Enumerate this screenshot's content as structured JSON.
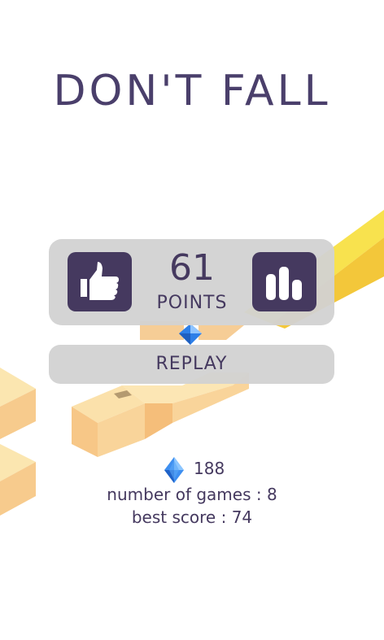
{
  "title": "DON'T FALL",
  "score": {
    "value": "61",
    "label": "POINTS"
  },
  "buttons": {
    "like_icon": "thumbs-up-icon",
    "stats_icon": "bar-chart-icon",
    "replay_label": "REPLAY"
  },
  "stats": {
    "gem_icon": "diamond-gem-icon",
    "gems": "188",
    "games_label": "number of games :",
    "games_value": "8",
    "best_label": "best score :",
    "best_value": "74"
  },
  "colors": {
    "accent": "#45395f",
    "panel": "#d2d2d2",
    "block_top": "#fbe7a9",
    "block_side": "#f6c98a",
    "gem": "#3e8ff0",
    "yellow_block": "#f8dc3c"
  }
}
